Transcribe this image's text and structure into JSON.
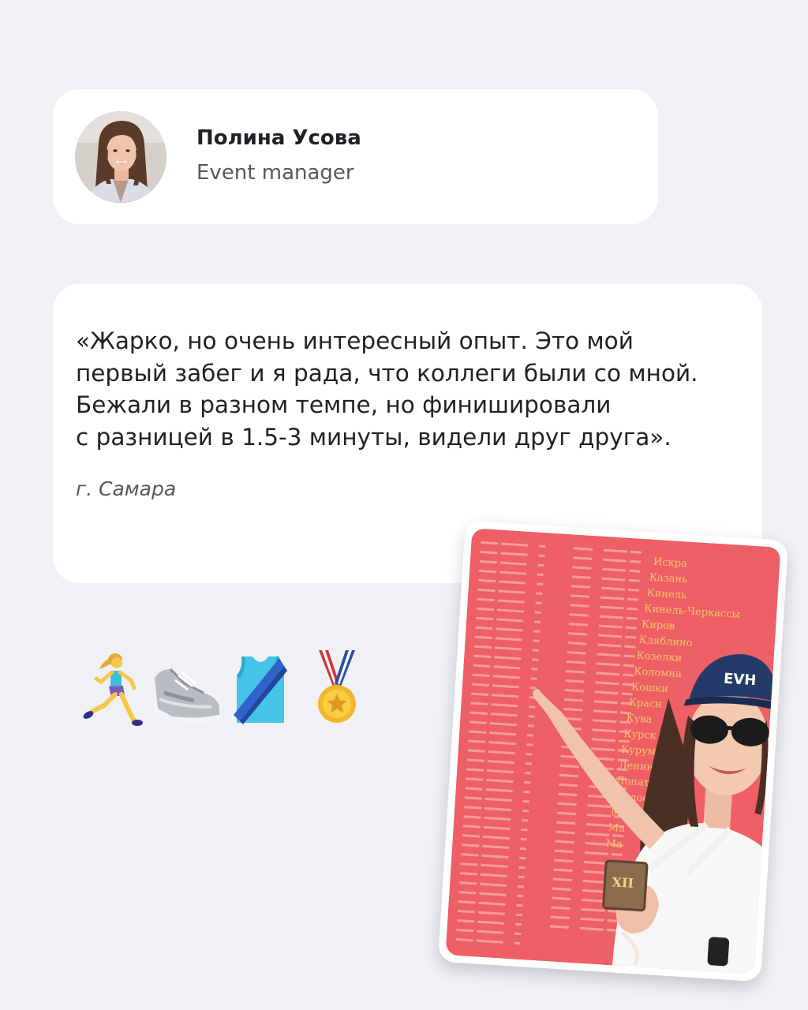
{
  "author": {
    "name": "Полина Усова",
    "role": "Event manager"
  },
  "quote": {
    "lines": [
      "«Жарко, но очень интересный опыт. Это мой",
      "первый забег и я рада, что коллеги были со мной.",
      "Бежали в разном темпе, но финишировали",
      "с разницей в 1.5-3 минуты, видели друг друга»."
    ],
    "city": "г. Самара"
  },
  "emojis": [
    "woman-running-icon",
    "sneaker-icon",
    "running-shirt-icon",
    "medal-icon"
  ],
  "photo": {
    "wall_cities": [
      "Искра",
      "Казань",
      "Кинель",
      "Кинель-Черкассы",
      "Киров",
      "Кляблино",
      "Козелки",
      "Коломна",
      "Кошки",
      "Красн",
      "Кува",
      "Курск",
      "Курум",
      "Ленино",
      "Лопати",
      "Малое",
      "Марк",
      "Ма",
      "Ма"
    ],
    "cap_text": "EVH",
    "medal_text": "XII",
    "colors": {
      "wall": "#ee5f66",
      "wall_text": "#f6c36a",
      "cap": "#243a68"
    }
  }
}
